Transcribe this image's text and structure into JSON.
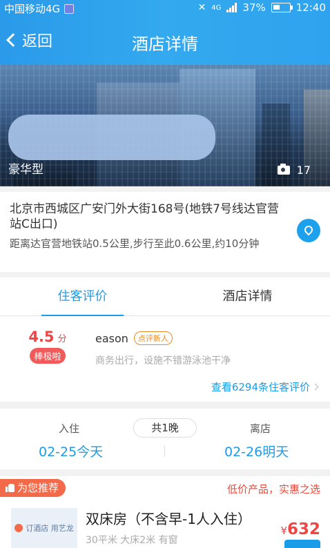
{
  "status": {
    "carrier": "中国移动4G",
    "network": "4G",
    "battery": "37%",
    "time": "12:40"
  },
  "nav": {
    "back_label": "返回",
    "title": "酒店详情"
  },
  "hero": {
    "room_type": "豪华型",
    "photo_count": "17"
  },
  "address": {
    "line": "北京市西城区广安门外大街168号(地铁7号线达官营站C出口)",
    "distance": "距离达官营地铁站0.5公里,步行至此0.6公里,约10分钟"
  },
  "tabs": [
    {
      "label": "住客评价",
      "active": true
    },
    {
      "label": "酒店详情",
      "active": false
    }
  ],
  "review": {
    "score": "4.5",
    "score_unit": "分",
    "score_label": "棒极啦",
    "reviewer": "eason",
    "reviewer_tag": "点评新人",
    "comment": "商务出行，设施不错游泳池干净",
    "more_link": "查看6294条住客评价"
  },
  "dates": {
    "checkin_label": "入住",
    "checkout_label": "离店",
    "nights": "共1晚",
    "checkin_date": "02-25今天",
    "checkout_date": "02-26明天"
  },
  "recommend": {
    "ribbon": "为您推荐",
    "promo": "低价产品，实惠之选",
    "thumb_text": "订酒店 用艺龙",
    "room_name": "双床房（不含早-1人入住）",
    "room_info": "30平米  大床2米  有窗",
    "currency": "¥",
    "price": "632"
  },
  "colors": {
    "accent": "#1a9ce8",
    "price": "#f04545",
    "ribbon": "#f26a4a"
  }
}
